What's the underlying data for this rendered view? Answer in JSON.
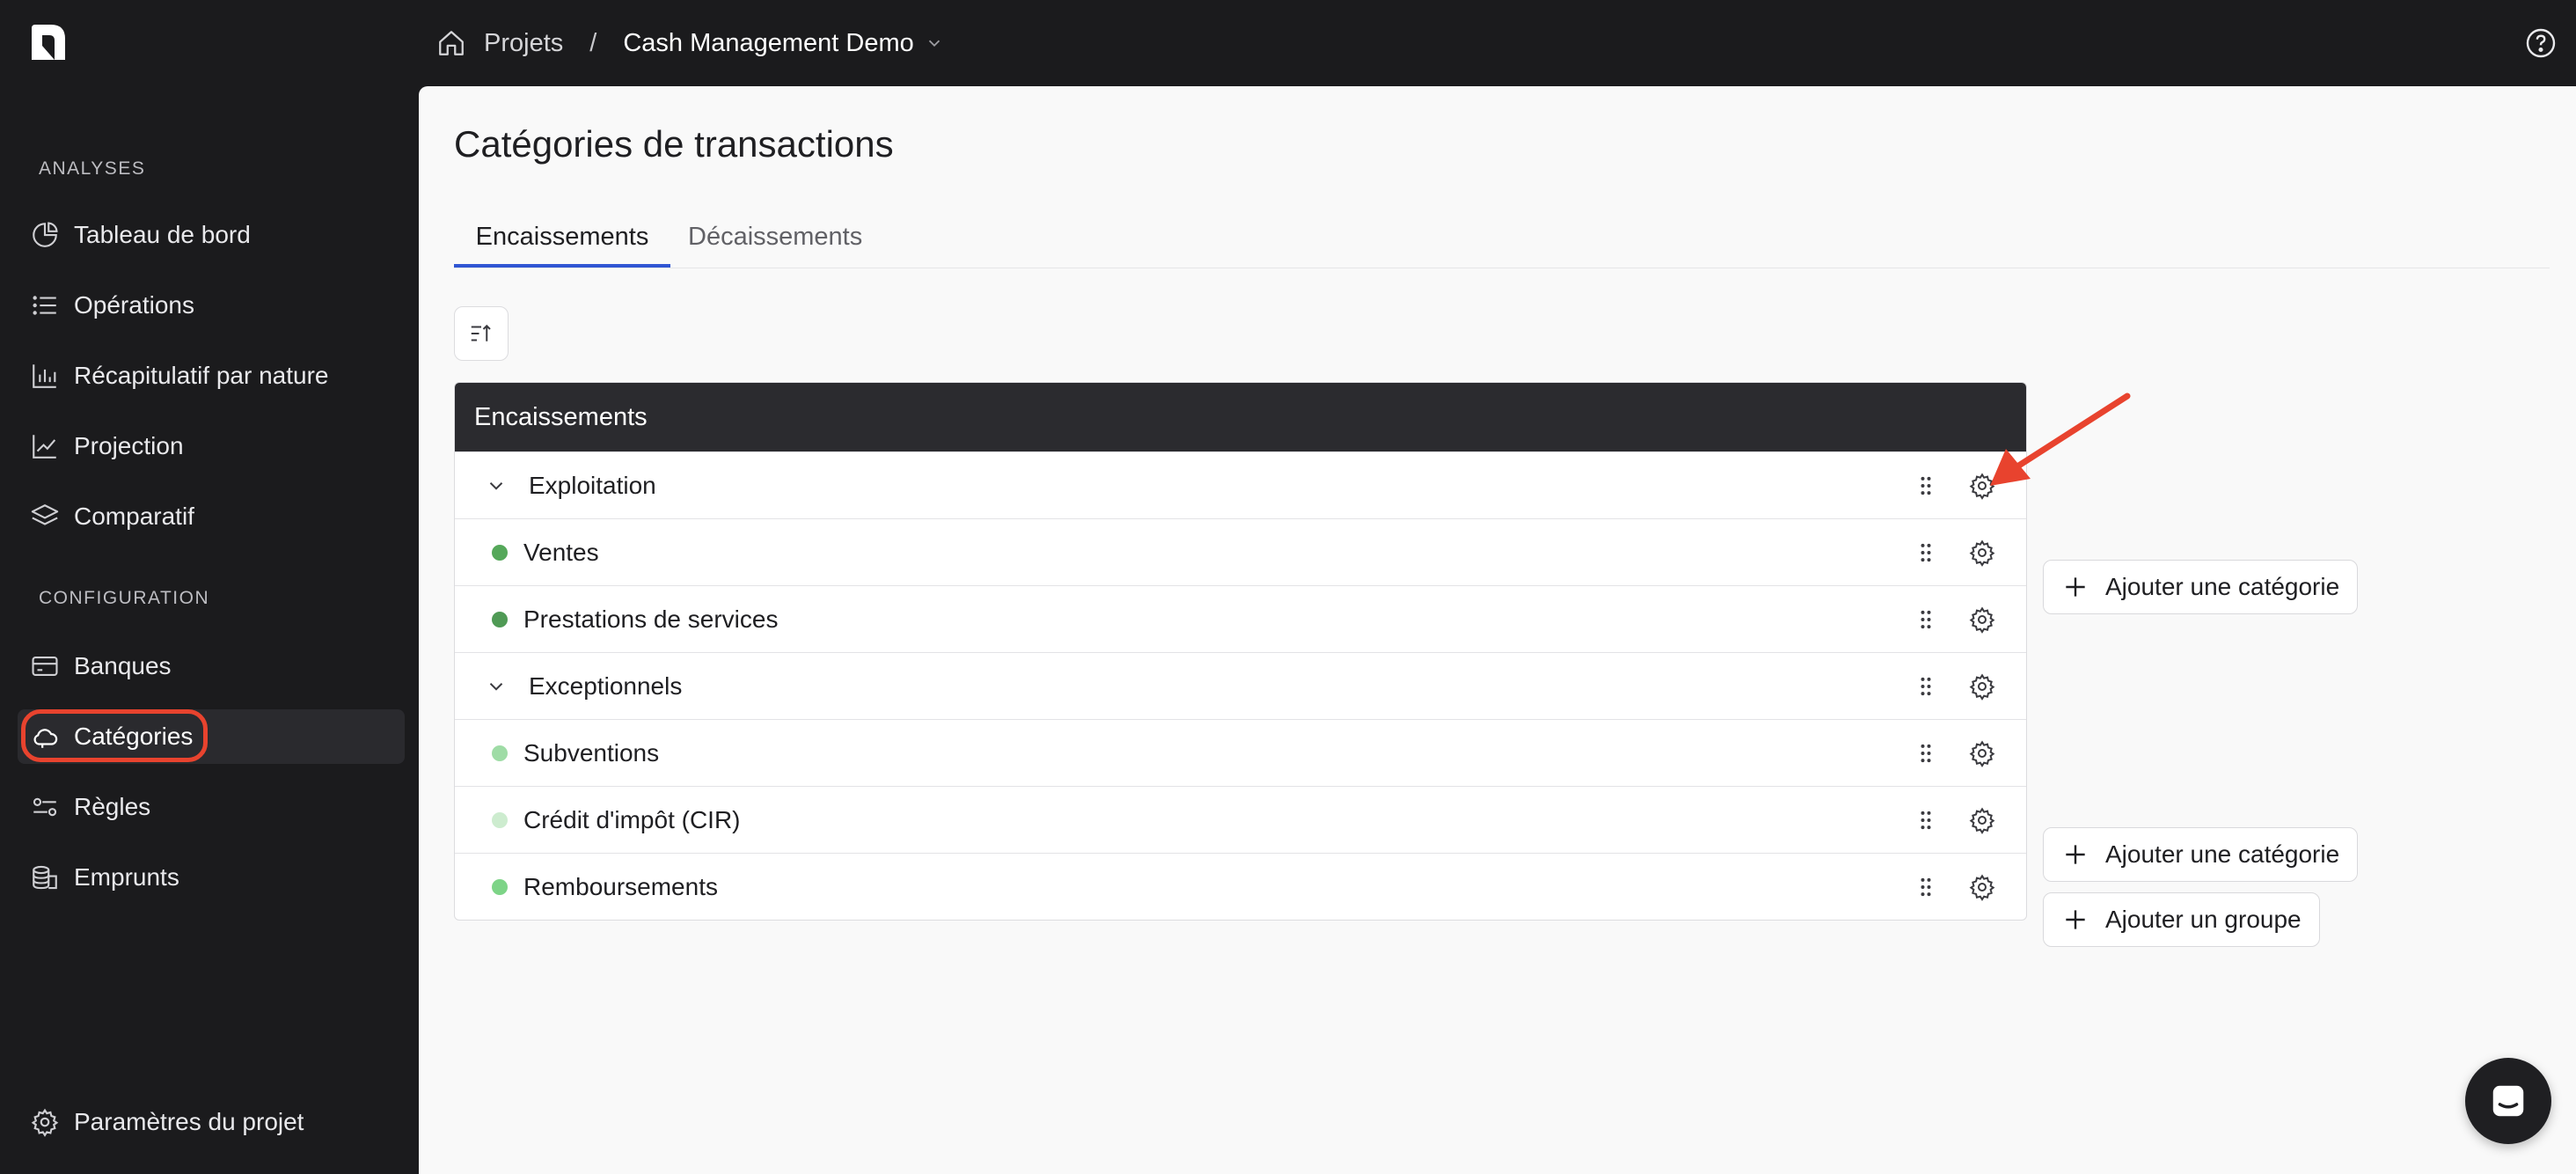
{
  "breadcrumb": {
    "root": "Projets",
    "separator": "/",
    "project": "Cash Management Demo"
  },
  "sidebar": {
    "sections": [
      {
        "label": "ANALYSES"
      },
      {
        "label": "CONFIGURATION"
      }
    ],
    "items": [
      {
        "label": "Tableau de bord",
        "icon": "pie-chart-icon"
      },
      {
        "label": "Opérations",
        "icon": "list-icon"
      },
      {
        "label": "Récapitulatif par nature",
        "icon": "bar-chart-icon"
      },
      {
        "label": "Projection",
        "icon": "line-chart-icon"
      },
      {
        "label": "Comparatif",
        "icon": "layers-icon"
      },
      {
        "label": "Banques",
        "icon": "bank-card-icon"
      },
      {
        "label": "Catégories",
        "icon": "cloud-icon"
      },
      {
        "label": "Règles",
        "icon": "rules-icon"
      },
      {
        "label": "Emprunts",
        "icon": "coins-icon"
      }
    ],
    "footer": {
      "label": "Paramètres du projet",
      "icon": "gear-icon"
    }
  },
  "main": {
    "title": "Catégories de transactions",
    "tabs": [
      {
        "label": "Encaissements"
      },
      {
        "label": "Décaissements"
      }
    ],
    "table": {
      "header": "Encaissements",
      "rows": [
        {
          "type": "group",
          "label": "Exploitation"
        },
        {
          "type": "category",
          "label": "Ventes",
          "color": "#55a85a"
        },
        {
          "type": "category",
          "label": "Prestations de services",
          "color": "#4f9a55"
        },
        {
          "type": "group",
          "label": "Exceptionnels"
        },
        {
          "type": "category",
          "label": "Subventions",
          "color": "#9fdca6"
        },
        {
          "type": "category",
          "label": "Crédit d'impôt (CIR)",
          "color": "#cdeccf"
        },
        {
          "type": "category",
          "label": "Remboursements",
          "color": "#7dd487"
        }
      ]
    },
    "actions": {
      "add_category": "Ajouter une catégorie",
      "add_group": "Ajouter un groupe"
    }
  },
  "colors": {
    "accent": "#3056d3",
    "highlight": "#e8432e",
    "sidebar_bg": "#1b1b1d"
  }
}
